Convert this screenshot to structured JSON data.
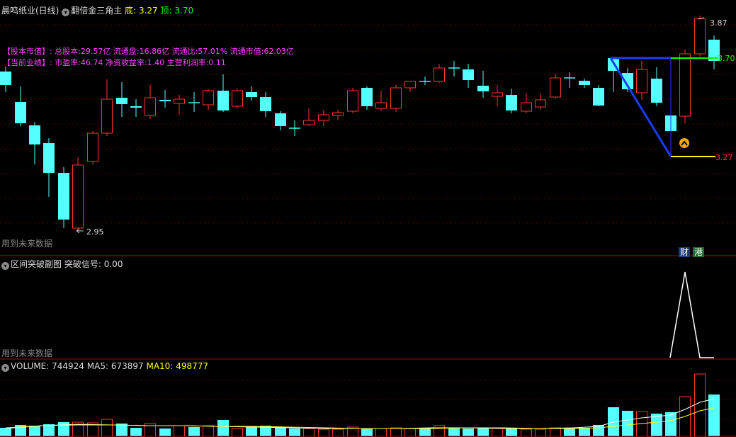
{
  "main": {
    "stock_title": "晨鸣纸业(日线)",
    "indicator_name": "翻倍金三角主",
    "bottom_label": "底",
    "bottom_value": "3.27",
    "top_label": "顶",
    "top_value": "3.70",
    "info_line1": "【股本市值】: 总股本:29.57亿 流通盘:16.86亿 流通比:57.01% 流通市值:62.03亿",
    "info_line2": "【当前业绩】: 市盈率:46.74 净资收益率:1.40 主营利润率:0.11",
    "high_price_label": "3.87",
    "low_price_label": "2.95",
    "level_top_label": "3.70",
    "level_bottom_label": "3.27",
    "future_data_note": "用到未来数据",
    "badge_finance": "财",
    "badge_hk": "港"
  },
  "signal_panel": {
    "title": "区间突破副图",
    "signal_label": "突破信号",
    "signal_value": "0.00",
    "future_data_note": "用到未来数据"
  },
  "volume_panel": {
    "label": "VOLUME",
    "volume_value": "744924",
    "ma5_label": "MA5",
    "ma5_value": "673897",
    "ma10_label": "MA10",
    "ma10_value": "498777"
  },
  "colors": {
    "up": "#ff3232",
    "down": "#54ffff",
    "ma5": "#ffffff",
    "ma10": "#ffff00",
    "bottom_label": "#ffff00",
    "top_label": "#00ff00",
    "info_text": "#ff44ff",
    "triangle": "#1a3cff",
    "level_top": "#00ff00",
    "level_bottom": "#ffff00"
  }
}
